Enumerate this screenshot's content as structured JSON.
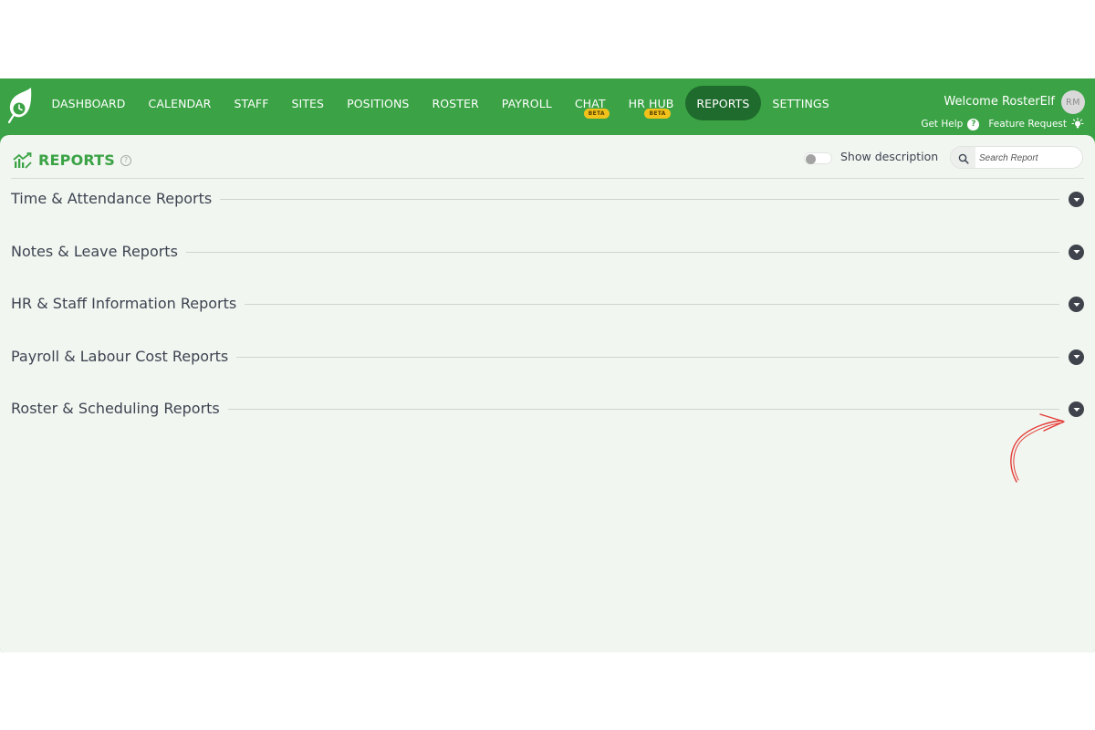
{
  "brand": {
    "accent": "#3ba345",
    "active_nav_bg": "#1f6a2d",
    "beta_badge": "#f2c21b",
    "panel_bg": "#f1f6f0",
    "annotation": "#e53935"
  },
  "nav": {
    "items": [
      {
        "label": "DASHBOARD"
      },
      {
        "label": "CALENDAR"
      },
      {
        "label": "STAFF"
      },
      {
        "label": "SITES"
      },
      {
        "label": "POSITIONS"
      },
      {
        "label": "ROSTER"
      },
      {
        "label": "PAYROLL"
      },
      {
        "label": "CHAT",
        "badge": "BETA"
      },
      {
        "label": "HR HUB",
        "badge": "BETA"
      },
      {
        "label": "REPORTS",
        "active": true
      },
      {
        "label": "SETTINGS"
      }
    ]
  },
  "user": {
    "welcome": "Welcome RosterElf",
    "initials": "RM"
  },
  "links": {
    "help": "Get Help",
    "help_glyph": "?",
    "feature": "Feature Request"
  },
  "page": {
    "title": "REPORTS",
    "info_glyph": "?"
  },
  "toolbar": {
    "toggle_label": "Show description",
    "toggle_on": false,
    "search_placeholder": "Search Report"
  },
  "sections": [
    {
      "label": "Time & Attendance Reports"
    },
    {
      "label": "Notes & Leave Reports"
    },
    {
      "label": "HR & Staff Information Reports"
    },
    {
      "label": "Payroll & Labour Cost Reports"
    },
    {
      "label": "Roster & Scheduling Reports"
    }
  ],
  "icons": {
    "logo": "leaf-clock-logo-icon",
    "reports": "growth-chart-icon",
    "search": "search-icon",
    "help": "question-circle-icon",
    "feature": "lightbulb-icon",
    "section_toggle": "chevron-down-circle-icon"
  }
}
